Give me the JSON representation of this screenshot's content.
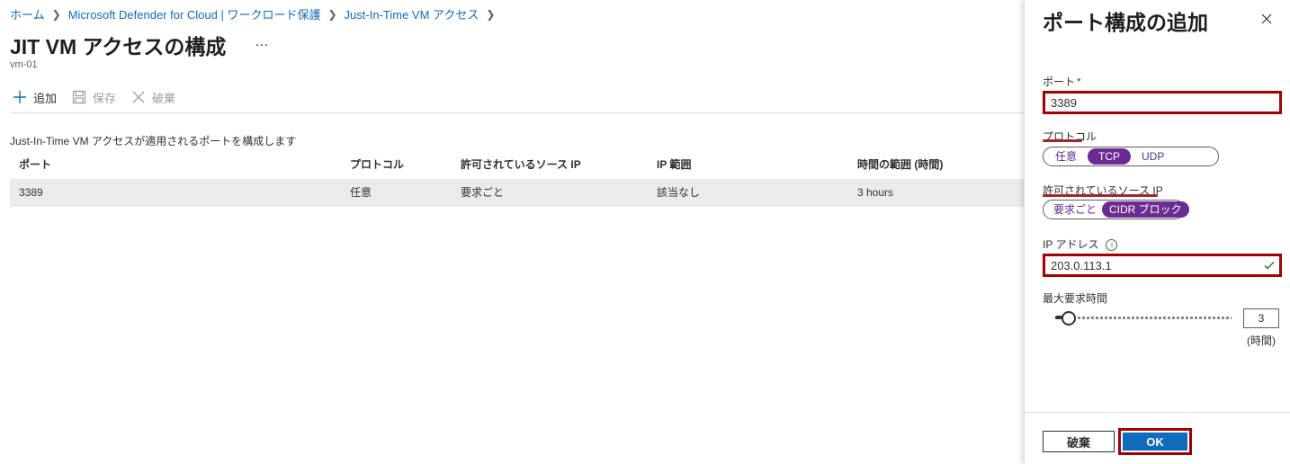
{
  "breadcrumb": {
    "items": [
      "ホーム",
      "Microsoft Defender for Cloud | ワークロード保護",
      "Just-In-Time VM アクセス"
    ]
  },
  "page": {
    "title": "JIT VM アクセスの構成",
    "more": "…",
    "subtitle": "vm-01"
  },
  "toolbar": {
    "add_label": "追加",
    "save_label": "保存",
    "discard_label": "破棄"
  },
  "table": {
    "caption": "Just-In-Time VM アクセスが適用されるポートを構成します",
    "headers": [
      "ポート",
      "プロトコル",
      "許可されているソース IP",
      "IP 範囲",
      "時間の範囲 (時間)"
    ],
    "rows": [
      [
        "3389",
        "任意",
        "要求ごと",
        "該当なし",
        "3 hours"
      ]
    ]
  },
  "panel": {
    "title": "ポート構成の追加",
    "port": {
      "label": "ポート",
      "required_mark": "*",
      "value": "3389"
    },
    "protocol": {
      "label": "プロトコル",
      "options": [
        "任意",
        "TCP",
        "UDP"
      ],
      "selected": "TCP"
    },
    "source": {
      "label": "許可されているソース IP",
      "options": [
        "要求ごと",
        "CIDR ブロック"
      ],
      "selected": "CIDR ブロック"
    },
    "ip": {
      "label": "IP アドレス",
      "info": "i",
      "value": "203.0.113.1"
    },
    "max_time": {
      "label": "最大要求時間",
      "value": "3",
      "unit": "(時間)",
      "slider_fraction": 0.06
    },
    "discard_label": "破棄",
    "ok_label": "OK"
  },
  "colors": {
    "accent": "#0f6cbd",
    "selected_pill": "#6b2c91",
    "highlight": "#a80000"
  }
}
